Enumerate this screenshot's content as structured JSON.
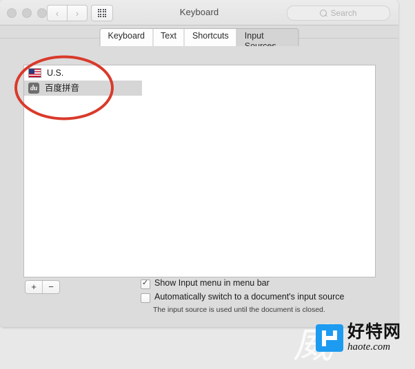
{
  "window": {
    "title": "Keyboard",
    "traffic_lights": [
      "close",
      "minimize",
      "zoom"
    ],
    "nav": {
      "back": "‹",
      "forward": "›"
    },
    "grid_button": "all-preferences-grid",
    "search": {
      "placeholder": "Search",
      "value": ""
    }
  },
  "tabs": [
    {
      "label": "Keyboard",
      "selected": false
    },
    {
      "label": "Text",
      "selected": false
    },
    {
      "label": "Shortcuts",
      "selected": false
    },
    {
      "label": "Input Sources",
      "selected": true
    }
  ],
  "input_sources": {
    "items": [
      {
        "label": "U.S.",
        "icon": "us-flag-icon",
        "selected": false
      },
      {
        "label": "百度拼音",
        "icon": "du-icon",
        "icon_text": "du",
        "selected": true
      }
    ],
    "add_button": "+",
    "remove_button": "−"
  },
  "options": [
    {
      "label": "Show Input menu in menu bar",
      "checked": true,
      "hint": ""
    },
    {
      "label": "Automatically switch to a document's input source",
      "checked": false,
      "hint": "The input source is used until the document is closed."
    }
  ],
  "annotation": {
    "type": "ellipse",
    "color": "#d93a2b",
    "stroke_width": 4
  },
  "watermark": {
    "faint_text": "威",
    "logo_letter": "H",
    "chinese": "好特网",
    "domain": "haote.com",
    "logo_color": "#1d9bf0"
  }
}
